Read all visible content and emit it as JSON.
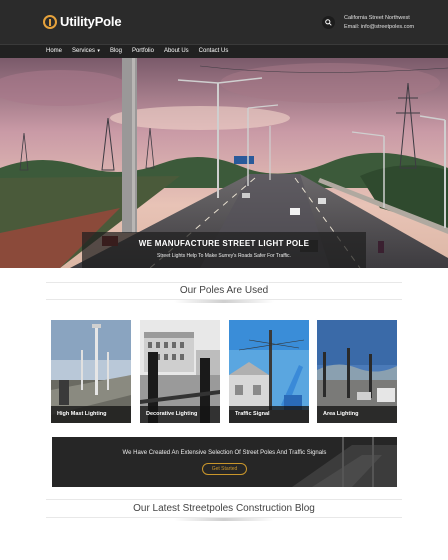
{
  "header": {
    "logo_text": "UtilityPole",
    "address": "California Street Northwest",
    "email": "Email: info@streetpoles.com"
  },
  "nav": {
    "items": [
      "Home",
      "Services",
      "Blog",
      "Portfolio",
      "About Us",
      "Contact Us"
    ]
  },
  "hero": {
    "title": "WE MANUFACTURE STREET LIGHT POLE",
    "subtitle": "Street Lights Help To Make Surrey's Roads Safer For Traffic."
  },
  "poles_section": {
    "title": "Our Poles Are Used",
    "cards": [
      {
        "label": "High Mast Lighting"
      },
      {
        "label": "Decorative Lighting"
      },
      {
        "label": "Traffic Signal"
      },
      {
        "label": "Area Lighting"
      }
    ]
  },
  "cta": {
    "text": "We Have Created An Extensive Selection Of Street Poles And Traffic Signals",
    "button": "Get Started"
  },
  "blog_section": {
    "title": "Our Latest Streetpoles Construction Blog"
  },
  "colors": {
    "header_bg": "#2b2b2b",
    "nav_bg": "#212121",
    "accent": "#c9962b"
  }
}
